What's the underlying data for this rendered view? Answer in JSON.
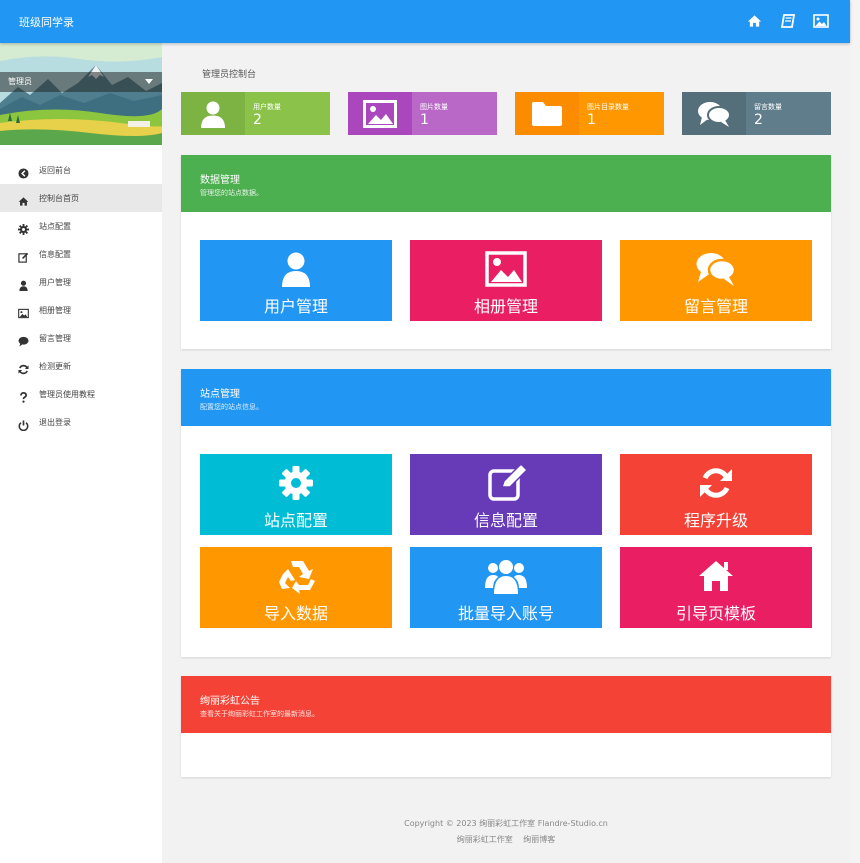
{
  "header": {
    "title": "班级同学录",
    "icons": [
      "home-icon",
      "book-icon",
      "image-icon"
    ]
  },
  "sidebar": {
    "admin_name": "管理员",
    "items": [
      {
        "label": "返回前台",
        "icon": "circle-arrow-left-icon"
      },
      {
        "label": "控制台首页",
        "icon": "home-icon",
        "active": true
      },
      {
        "label": "站点配置",
        "icon": "gear-icon"
      },
      {
        "label": "信息配置",
        "icon": "edit-icon"
      },
      {
        "label": "用户管理",
        "icon": "user-icon"
      },
      {
        "label": "相册管理",
        "icon": "image-icon"
      },
      {
        "label": "留言管理",
        "icon": "comment-icon"
      },
      {
        "label": "检测更新",
        "icon": "refresh-icon"
      },
      {
        "label": "管理员使用教程",
        "icon": "question-icon"
      },
      {
        "label": "退出登录",
        "icon": "power-icon"
      }
    ]
  },
  "breadcrumb": "管理员控制台",
  "stats": [
    {
      "label": "用户数量",
      "value": "2",
      "color": "#8bc34a",
      "dark": "#7cb342",
      "icon": "user-icon"
    },
    {
      "label": "图片数量",
      "value": "1",
      "color": "#ba68c8",
      "dark": "#ab47bc",
      "icon": "image-icon"
    },
    {
      "label": "图片目录数量",
      "value": "1",
      "color": "#ff9800",
      "dark": "#fb8c00",
      "icon": "folder-icon"
    },
    {
      "label": "留言数量",
      "value": "2",
      "color": "#607d8b",
      "dark": "#546e7a",
      "icon": "comments-icon"
    }
  ],
  "panels": {
    "data": {
      "title": "数据管理",
      "subtitle": "管理您的站点数据。",
      "color": "#4caf50",
      "tiles": [
        {
          "label": "用户管理",
          "color": "#2196f3",
          "icon": "user-icon"
        },
        {
          "label": "相册管理",
          "color": "#e91e63",
          "icon": "image-icon"
        },
        {
          "label": "留言管理",
          "color": "#ff9800",
          "icon": "comments-icon"
        }
      ]
    },
    "site": {
      "title": "站点管理",
      "subtitle": "配置您的站点信息。",
      "color": "#2196f3",
      "tiles": [
        {
          "label": "站点配置",
          "color": "#00bcd4",
          "icon": "gear-icon"
        },
        {
          "label": "信息配置",
          "color": "#673ab7",
          "icon": "edit-icon"
        },
        {
          "label": "程序升级",
          "color": "#f44336",
          "icon": "refresh-icon"
        },
        {
          "label": "导入数据",
          "color": "#ff9800",
          "icon": "recycle-icon"
        },
        {
          "label": "批量导入账号",
          "color": "#2196f3",
          "icon": "users-icon"
        },
        {
          "label": "引导页模板",
          "color": "#e91e63",
          "icon": "home-icon"
        }
      ]
    },
    "notice": {
      "title": "绚丽彩虹公告",
      "subtitle": "查看关于绚丽彩虹工作室的最新消息。",
      "color": "#f44336"
    }
  },
  "footer": {
    "copyright": "Copyright © 2023 绚丽彩虹工作室 Flandre-Studio.cn",
    "links": [
      "绚丽彩虹工作室",
      "绚丽博客"
    ]
  }
}
